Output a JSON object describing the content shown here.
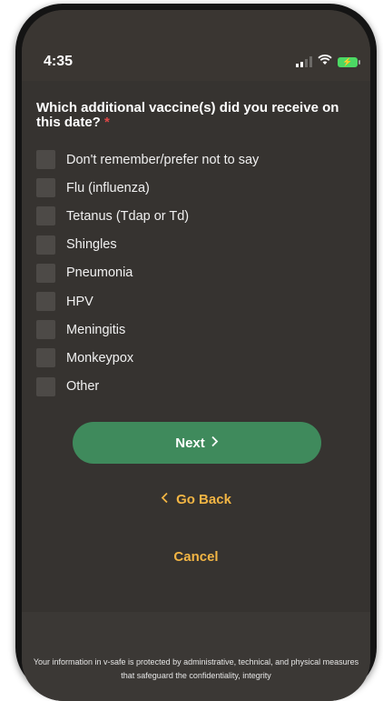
{
  "status_bar": {
    "time": "4:35",
    "icons": [
      "signal-icon",
      "wifi-icon",
      "battery-charging-icon"
    ]
  },
  "question": {
    "text": "Which additional vaccine(s) did you receive on this date?",
    "required_marker": "*"
  },
  "options": [
    {
      "label": "Don't remember/prefer not to say",
      "checked": false
    },
    {
      "label": "Flu (influenza)",
      "checked": false
    },
    {
      "label": "Tetanus (Tdap or Td)",
      "checked": false
    },
    {
      "label": "Shingles",
      "checked": false
    },
    {
      "label": "Pneumonia",
      "checked": false
    },
    {
      "label": "HPV",
      "checked": false
    },
    {
      "label": "Meningitis",
      "checked": false
    },
    {
      "label": "Monkeypox",
      "checked": false
    },
    {
      "label": "Other",
      "checked": false
    }
  ],
  "actions": {
    "next_label": "Next",
    "next_icon": "chevron-right",
    "back_label": "Go Back",
    "back_icon": "chevron-left",
    "cancel_label": "Cancel"
  },
  "footer": {
    "text": "Your information in v-safe is protected by administrative, technical, and physical measures that safeguard the confidentiality, integrity"
  },
  "colors": {
    "background": "#363330",
    "primary_button": "#3f8a5c",
    "link": "#f2b544",
    "required": "#e04848",
    "checkbox": "#4d4a47"
  }
}
